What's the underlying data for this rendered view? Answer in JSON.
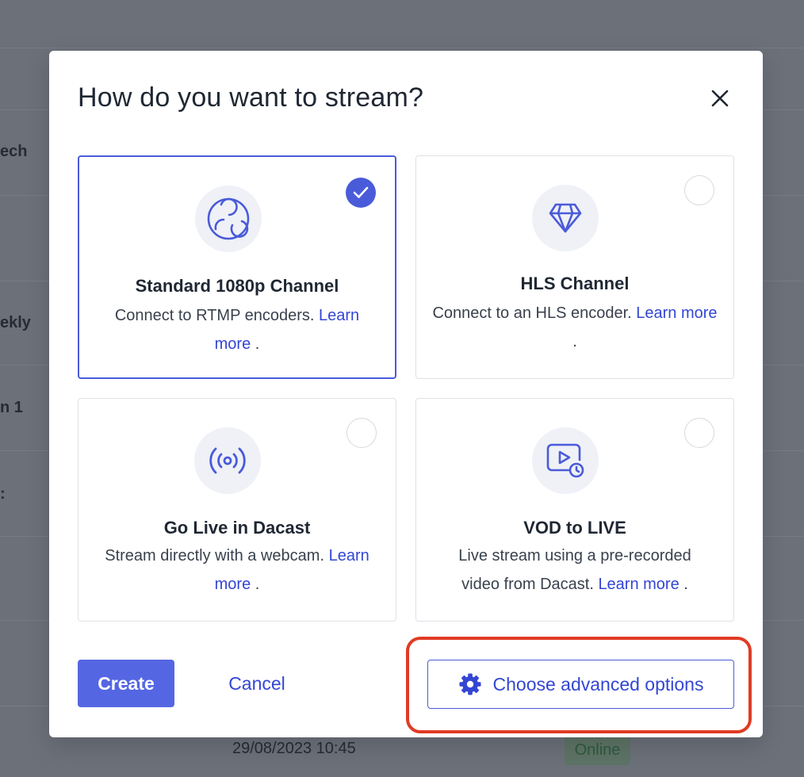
{
  "background": {
    "rows": [
      "ech",
      "ekly",
      "n 1",
      ":"
    ],
    "date": "29/08/2023 10:45",
    "status_badge": "Online"
  },
  "modal": {
    "title": "How do you want to stream?",
    "close_icon": "close-icon",
    "options": [
      {
        "title": "Standard 1080p Channel",
        "desc": "Connect to RTMP encoders.",
        "link": "Learn more",
        "suffix": ".",
        "icon": "obs-icon",
        "selected": true
      },
      {
        "title": "HLS Channel",
        "desc": "Connect to an HLS encoder.",
        "link": "Learn more",
        "suffix": ".",
        "icon": "diamond-icon",
        "selected": false
      },
      {
        "title": "Go Live in Dacast",
        "desc": "Stream directly with a webcam.",
        "link": "Learn more",
        "suffix": ".",
        "icon": "broadcast-icon",
        "selected": false
      },
      {
        "title": "VOD to LIVE",
        "desc": "Live stream using a pre-recorded video from Dacast.",
        "link": "Learn more",
        "suffix": ".",
        "icon": "video-clock-icon",
        "selected": false
      }
    ],
    "buttons": {
      "create": "Create",
      "cancel": "Cancel",
      "advanced": "Choose advanced options"
    }
  },
  "colors": {
    "accent": "#4a5bd9",
    "primary_button": "#5566e3",
    "link": "#3346d3",
    "highlight": "#e03b24",
    "overlay": "#6b7079"
  }
}
